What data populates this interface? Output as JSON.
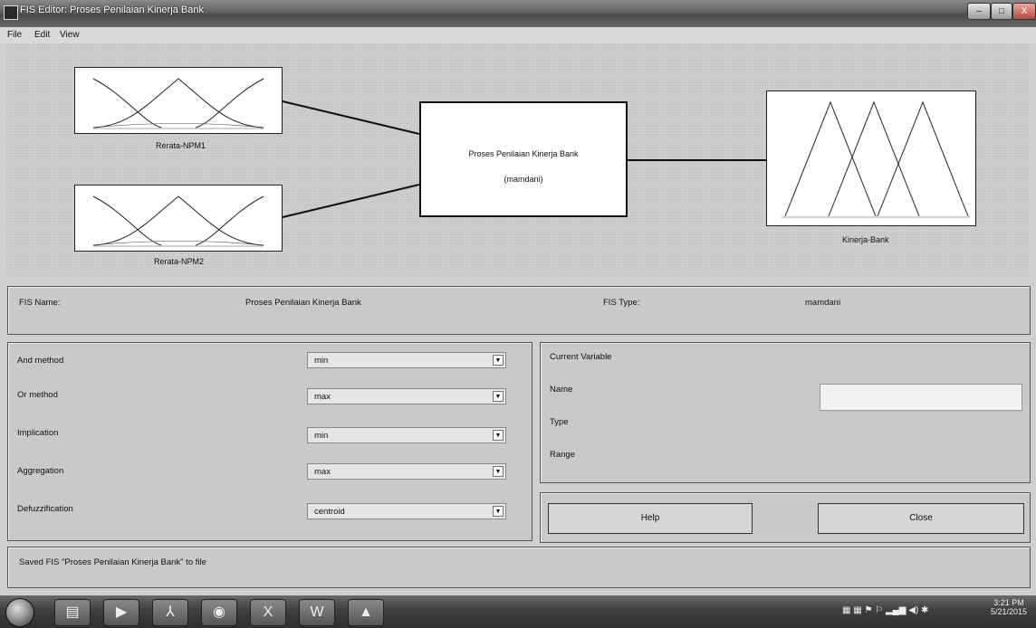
{
  "window": {
    "title": "FIS Editor: Proses Penilaian Kinerja Bank",
    "minimize": "–",
    "maximize": "□",
    "close": "X"
  },
  "menu": {
    "items": [
      "File",
      "Edit",
      "View"
    ]
  },
  "diagram": {
    "inputs": [
      {
        "label": "Rerata-NPM1"
      },
      {
        "label": "Rerata-NPM2"
      }
    ],
    "system": {
      "name": "Proses Penilaian Kinerja Bank",
      "type": "(mamdani)"
    },
    "output": {
      "label": "Kinerja-Bank"
    }
  },
  "fis": {
    "name_label": "FIS Name:",
    "name_value": "Proses Penilaian Kinerja Bank",
    "type_label": "FIS Type:",
    "type_value": "mamdani"
  },
  "methods": [
    {
      "label": "And method",
      "value": "min"
    },
    {
      "label": "Or method",
      "value": "max"
    },
    {
      "label": "Implication",
      "value": "min"
    },
    {
      "label": "Aggregation",
      "value": "max"
    },
    {
      "label": "Defuzzification",
      "value": "centroid"
    }
  ],
  "current_variable": {
    "title": "Current Variable",
    "name_label": "Name",
    "type_label": "Type",
    "range_label": "Range",
    "name_value": ""
  },
  "buttons": {
    "help": "Help",
    "close": "Close"
  },
  "status": "Saved FIS \"Proses Penilaian Kinerja Bank\" to file",
  "taskbar": {
    "time": "3:21 PM",
    "date": "5/21/2015",
    "apps": [
      "folder-icon",
      "media-player-icon",
      "pdf-icon",
      "chrome-icon",
      "excel-icon",
      "word-icon",
      "matlab-icon"
    ]
  }
}
